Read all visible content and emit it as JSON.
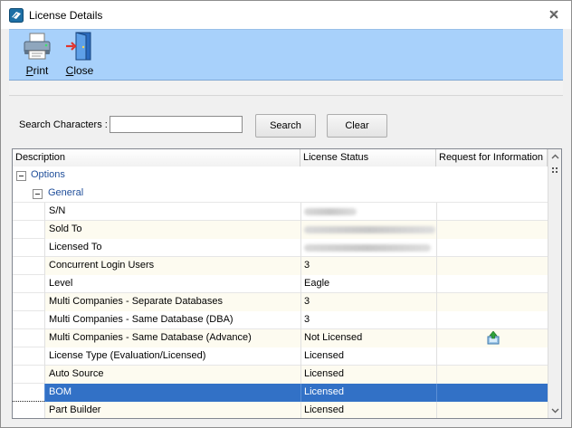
{
  "window": {
    "title": "License Details",
    "icon": "license-app-icon"
  },
  "toolbar": {
    "print_label": "Print",
    "close_label": "Close"
  },
  "search": {
    "label": "Search Characters :",
    "value": "",
    "placeholder": "",
    "search_label": "Search",
    "clear_label": "Clear"
  },
  "grid": {
    "columns": [
      "Description",
      "License Status",
      "Request for Information"
    ],
    "groups": {
      "options": "Options",
      "general": "General"
    },
    "rows": [
      {
        "description": "S/N",
        "status": "",
        "status_redacted": true
      },
      {
        "description": "Sold To",
        "status": "",
        "status_redacted": true
      },
      {
        "description": "Licensed To",
        "status": "",
        "status_redacted": true
      },
      {
        "description": "Concurrent Login Users",
        "status": "3"
      },
      {
        "description": "Level",
        "status": "Eagle"
      },
      {
        "description": "Multi Companies - Separate Databases",
        "status": "3"
      },
      {
        "description": "Multi Companies - Same Database (DBA)",
        "status": "3"
      },
      {
        "description": "Multi Companies - Same Database (Advance)",
        "status": "Not Licensed",
        "request_icon": "upload-request-icon"
      },
      {
        "description": "License Type (Evaluation/Licensed)",
        "status": "Licensed"
      },
      {
        "description": "Auto Source",
        "status": "Licensed"
      },
      {
        "description": "BOM",
        "status": "Licensed",
        "selected": true
      },
      {
        "description": "Part Builder",
        "status": "Licensed"
      }
    ]
  },
  "colors": {
    "toolbar_bg": "#a8d1fb",
    "selection": "#3271c6",
    "group_text": "#1f4e9a"
  }
}
